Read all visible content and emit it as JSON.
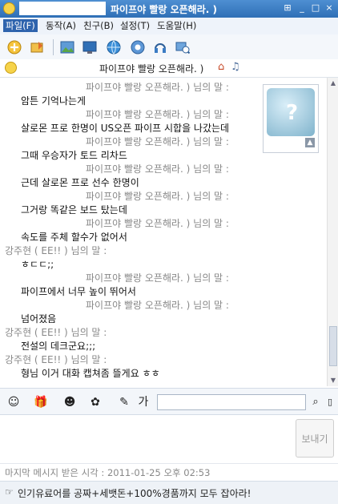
{
  "window": {
    "title": "파이프야 빨랑 오픈해라. )",
    "controls": [
      "⊞",
      "_",
      "□",
      "×"
    ],
    "accent": "#2f6fb6"
  },
  "menu": {
    "items": [
      "파일(F)",
      "동작(A)",
      "친구(B)",
      "설정(T)",
      "도움말(H)"
    ]
  },
  "toolbar": {
    "icons": [
      "add-friend-icon",
      "file-send-icon",
      "photo-icon",
      "screen-icon",
      "globe-icon",
      "video-call-icon",
      "headset-icon",
      "remote-icon"
    ]
  },
  "conversation": {
    "partner_title": "파이프야 빨랑 오픈해라. )"
  },
  "messages": {
    "m01": "파이프야 빨랑 오픈해라. ) 님의 말 :",
    "m02": "암튼 기억나는게",
    "m03": "파이프야 빨랑 오픈해라. ) 님의 말 :",
    "m04": "살로몬 프로 한명이 US오픈 파이프 시합을 나갔는데",
    "m05": "파이프야 빨랑 오픈해라. ) 님의 말 :",
    "m06": "그때 우승자가 토드 리차드",
    "m07": "파이프야 빨랑 오픈해라. ) 님의 말 :",
    "m08": "근데 살로몬 프로 선수 한명이",
    "m09": "파이프야 빨랑 오픈해라. ) 님의 말 :",
    "m10": "그거랑 똑같은 보드 탔는데",
    "m11": "파이프야 빨랑 오픈해라. ) 님의 말 :",
    "m12": "속도를 주체 할수가 없어서",
    "m13": "강주현 ( EE!! ) 님의 말 :",
    "m14": "ㅎㄷㄷ;;",
    "m15": "파이프야 빨랑 오픈해라. ) 님의 말 :",
    "m16": "파이프에서 너무 높이 뛰어서",
    "m17": "파이프야 빨랑 오픈해라. ) 님의 말 :",
    "m18": "넘어졌음",
    "m19": "강주현 ( EE!! ) 님의 말 :",
    "m20": "전설의 데크군요;;;",
    "m21": "강주현 ( EE!! ) 님의 말 :",
    "m22": "형님 이거 대화 캡쳐좀 뜰게요 ㅎㅎ"
  },
  "compose": {
    "send_label": "보내기"
  },
  "status": {
    "last_received": "마지막 메시지 받은 시각 : 2011-01-25 오후 02:53"
  },
  "ad": {
    "text": "인기유료어를 공짜+세뱃돈+100%경품까지 모두 잡아라!"
  }
}
